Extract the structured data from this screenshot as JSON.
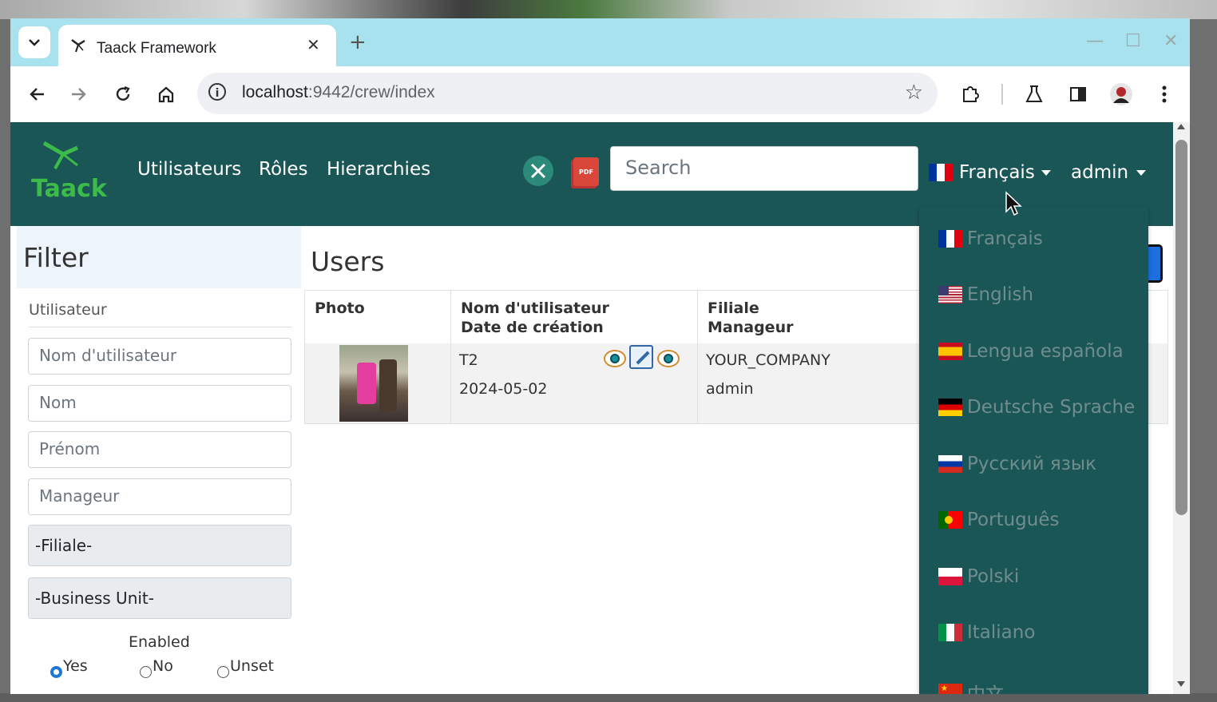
{
  "browser": {
    "tab_title": "Taack Framework",
    "url_host": "localhost",
    "url_rest": ":9442/crew/index",
    "info_glyph": "i"
  },
  "app": {
    "logo_text": "Taack",
    "nav": [
      "Utilisateurs",
      "Rôles",
      "Hierarchies"
    ],
    "pdf_label": "PDF",
    "search_placeholder": "Search",
    "current_language": "Français",
    "user": "admin"
  },
  "languages": [
    {
      "label": "Français",
      "flag": "fr"
    },
    {
      "label": "English",
      "flag": "us"
    },
    {
      "label": "Lengua española",
      "flag": "es"
    },
    {
      "label": "Deutsche Sprache",
      "flag": "de"
    },
    {
      "label": "Русский язык",
      "flag": "ru"
    },
    {
      "label": "Português",
      "flag": "pt"
    },
    {
      "label": "Polski",
      "flag": "pl"
    },
    {
      "label": "Italiano",
      "flag": "it"
    },
    {
      "label": "中文",
      "flag": "cn"
    }
  ],
  "filter": {
    "title": "Filter",
    "section": "Utilisateur",
    "inputs": [
      "Nom d'utilisateur",
      "Nom",
      "Prénom",
      "Manageur"
    ],
    "selects": [
      "-Filiale-",
      "-Business Unit-"
    ],
    "enabled_label": "Enabled",
    "radios": [
      "Yes",
      "No",
      "Unset"
    ],
    "selected_radio": "Yes"
  },
  "users": {
    "title": "Users",
    "headers": {
      "photo": "Photo",
      "user_1": "Nom d'utilisateur",
      "user_2": "Date de création",
      "sub_1": "Filiale",
      "sub_2": "Manageur"
    },
    "row": {
      "username": "T2",
      "created": "2024-05-02",
      "subsidiary": "YOUR_COMPANY",
      "manager": "admin"
    }
  },
  "colors": {
    "navbar": "#1b5656",
    "tabbar": "#a8e2ee",
    "accent": "#1d6fe0",
    "logo_green": "#3dbb49"
  }
}
